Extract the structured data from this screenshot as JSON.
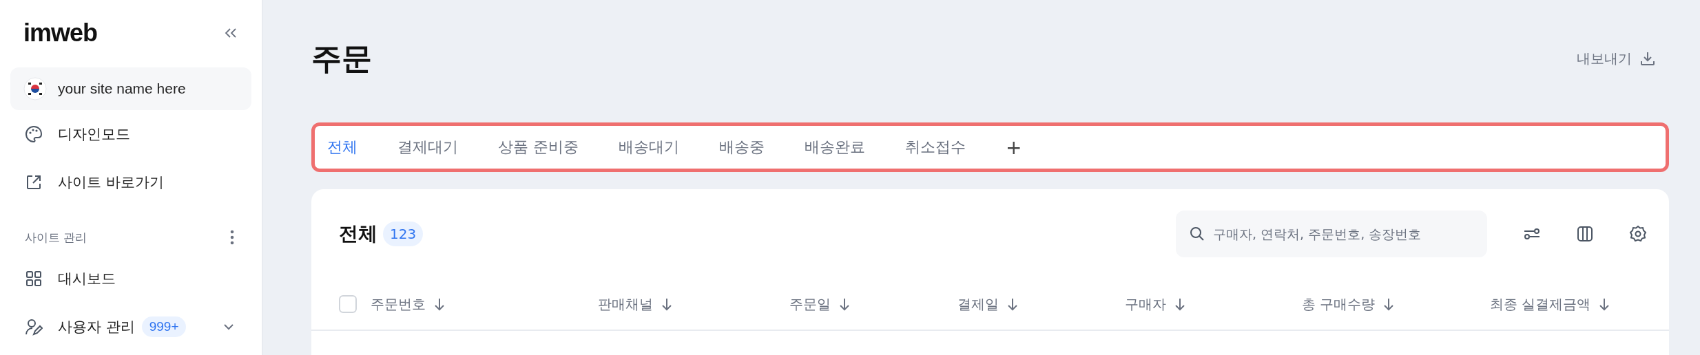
{
  "sidebar": {
    "logo": "imweb",
    "site": {
      "name": "your site name here"
    },
    "links": [
      {
        "label": "디자인모드",
        "kind": "design"
      },
      {
        "label": "사이트 바로가기",
        "kind": "external"
      }
    ],
    "section": {
      "title": "사이트 관리"
    },
    "items": [
      {
        "label": "대시보드",
        "kind": "dashboard",
        "expandable": false
      },
      {
        "label": "사용자 관리",
        "kind": "users",
        "badge": "999+",
        "expandable": true
      }
    ]
  },
  "page": {
    "title": "주문",
    "export": "내보내기"
  },
  "tabs": [
    {
      "label": "전체",
      "selected": true
    },
    {
      "label": "결제대기",
      "selected": false
    },
    {
      "label": "상품 준비중",
      "selected": false
    },
    {
      "label": "배송대기",
      "selected": false
    },
    {
      "label": "배송중",
      "selected": false
    },
    {
      "label": "배송완료",
      "selected": false
    },
    {
      "label": "취소접수",
      "selected": false
    }
  ],
  "add_tab": "+",
  "card": {
    "title": "전체",
    "count": "123",
    "search": {
      "placeholder": "구매자, 연락처, 주문번호, 송장번호"
    },
    "select_all": {
      "checked": false
    },
    "columns": [
      {
        "label": "주문번호"
      },
      {
        "label": "판매채널"
      },
      {
        "label": "주문일"
      },
      {
        "label": "결제일"
      },
      {
        "label": "구매자"
      },
      {
        "label": "총 구매수량"
      },
      {
        "label": "최종 실결제금액"
      }
    ]
  }
}
